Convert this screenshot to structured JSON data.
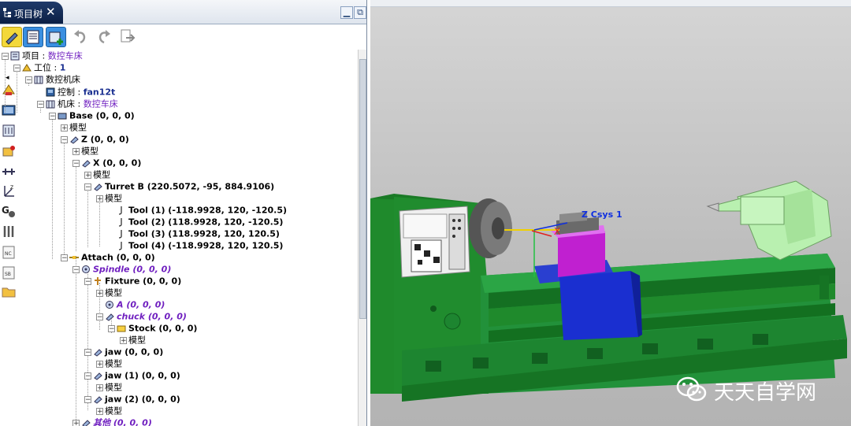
{
  "panel": {
    "tab_title": "项目树",
    "close_glyph": "✕",
    "minimize_glyph": "▁",
    "restore_glyph": "⧉"
  },
  "colors": {
    "tab_bg": "#0b1f44",
    "machine_green": "#1f8a2c",
    "tailstock_green": "#b9f0b0",
    "fixture_magenta": "#c020d0",
    "carriage_blue": "#1a2fd0",
    "label_purple": "#7020c0"
  },
  "toolbar": {
    "icons": [
      "edit-icon",
      "properties-icon",
      "add-component-icon",
      "undo-icon",
      "redo-icon",
      "export-icon"
    ]
  },
  "left_strip": {
    "icons": [
      "setup-icon",
      "screen-icon",
      "machine-icon",
      "workpiece-icon",
      "axis-icon",
      "coordinate-icon",
      "gcode-icon",
      "tools-icon",
      "nc-program-icon",
      "subroutine-icon",
      "folder-icon"
    ]
  },
  "tree": [
    {
      "text": "项目 : ",
      "value": "数控车床"
    },
    {
      "text": "工位 : ",
      "value": "1"
    },
    {
      "text": "数控机床",
      "value": ""
    },
    {
      "text": "控制 : ",
      "value": "fan12t"
    },
    {
      "text": "机床 : ",
      "value": "数控车床"
    },
    {
      "text": "Base (0, 0, 0)"
    },
    {
      "text": "模型"
    },
    {
      "text": "Z (0, 0, 0)"
    },
    {
      "text": "模型"
    },
    {
      "text": "X (0, 0, 0)"
    },
    {
      "text": "模型"
    },
    {
      "text": "Turret B (220.5072, -95, 884.9106)"
    },
    {
      "text": "模型"
    },
    {
      "text": "Tool (1) (-118.9928, 120, -120.5)"
    },
    {
      "text": "Tool (2) (118.9928, 120, -120.5)"
    },
    {
      "text": "Tool (3) (118.9928, 120, 120.5)"
    },
    {
      "text": "Tool (4) (-118.9928, 120, 120.5)"
    },
    {
      "text": "Attach (0, 0, 0)"
    },
    {
      "text": "Spindle (0, 0, 0)"
    },
    {
      "text": "Fixture (0, 0, 0)"
    },
    {
      "text": "模型"
    },
    {
      "text": "A (0, 0, 0)"
    },
    {
      "text": "chuck (0, 0, 0)"
    },
    {
      "text": "Stock (0, 0, 0)"
    },
    {
      "text": "模型"
    },
    {
      "text": "jaw (0, 0, 0)"
    },
    {
      "text": "模型"
    },
    {
      "text": "jaw (1) (0, 0, 0)"
    },
    {
      "text": "模型"
    },
    {
      "text": "jaw (2) (0, 0, 0)"
    },
    {
      "text": "模型"
    },
    {
      "text": "其他 (0, 0, 0)"
    }
  ],
  "viewport": {
    "csys_label": "Z Csys 1"
  },
  "watermark": {
    "text": "天天自学网"
  }
}
